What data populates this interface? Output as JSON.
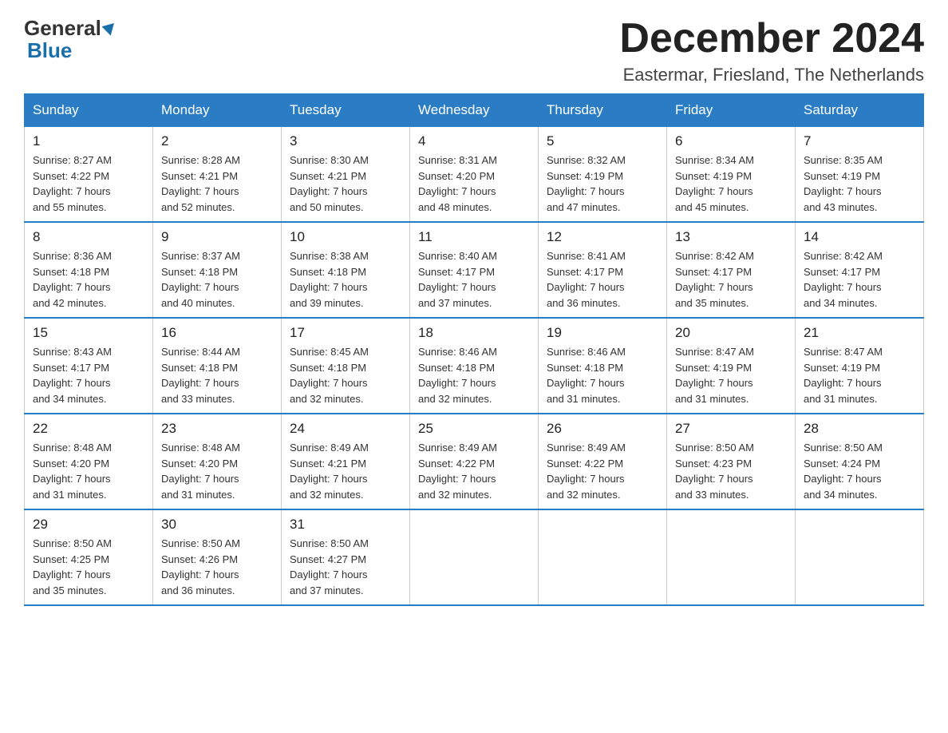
{
  "logo": {
    "line1": "General",
    "line2": "Blue"
  },
  "header": {
    "month": "December 2024",
    "location": "Eastermar, Friesland, The Netherlands"
  },
  "weekdays": [
    "Sunday",
    "Monday",
    "Tuesday",
    "Wednesday",
    "Thursday",
    "Friday",
    "Saturday"
  ],
  "weeks": [
    [
      {
        "day": "1",
        "sunrise": "8:27 AM",
        "sunset": "4:22 PM",
        "daylight": "7 hours and 55 minutes."
      },
      {
        "day": "2",
        "sunrise": "8:28 AM",
        "sunset": "4:21 PM",
        "daylight": "7 hours and 52 minutes."
      },
      {
        "day": "3",
        "sunrise": "8:30 AM",
        "sunset": "4:21 PM",
        "daylight": "7 hours and 50 minutes."
      },
      {
        "day": "4",
        "sunrise": "8:31 AM",
        "sunset": "4:20 PM",
        "daylight": "7 hours and 48 minutes."
      },
      {
        "day": "5",
        "sunrise": "8:32 AM",
        "sunset": "4:19 PM",
        "daylight": "7 hours and 47 minutes."
      },
      {
        "day": "6",
        "sunrise": "8:34 AM",
        "sunset": "4:19 PM",
        "daylight": "7 hours and 45 minutes."
      },
      {
        "day": "7",
        "sunrise": "8:35 AM",
        "sunset": "4:19 PM",
        "daylight": "7 hours and 43 minutes."
      }
    ],
    [
      {
        "day": "8",
        "sunrise": "8:36 AM",
        "sunset": "4:18 PM",
        "daylight": "7 hours and 42 minutes."
      },
      {
        "day": "9",
        "sunrise": "8:37 AM",
        "sunset": "4:18 PM",
        "daylight": "7 hours and 40 minutes."
      },
      {
        "day": "10",
        "sunrise": "8:38 AM",
        "sunset": "4:18 PM",
        "daylight": "7 hours and 39 minutes."
      },
      {
        "day": "11",
        "sunrise": "8:40 AM",
        "sunset": "4:17 PM",
        "daylight": "7 hours and 37 minutes."
      },
      {
        "day": "12",
        "sunrise": "8:41 AM",
        "sunset": "4:17 PM",
        "daylight": "7 hours and 36 minutes."
      },
      {
        "day": "13",
        "sunrise": "8:42 AM",
        "sunset": "4:17 PM",
        "daylight": "7 hours and 35 minutes."
      },
      {
        "day": "14",
        "sunrise": "8:42 AM",
        "sunset": "4:17 PM",
        "daylight": "7 hours and 34 minutes."
      }
    ],
    [
      {
        "day": "15",
        "sunrise": "8:43 AM",
        "sunset": "4:17 PM",
        "daylight": "7 hours and 34 minutes."
      },
      {
        "day": "16",
        "sunrise": "8:44 AM",
        "sunset": "4:18 PM",
        "daylight": "7 hours and 33 minutes."
      },
      {
        "day": "17",
        "sunrise": "8:45 AM",
        "sunset": "4:18 PM",
        "daylight": "7 hours and 32 minutes."
      },
      {
        "day": "18",
        "sunrise": "8:46 AM",
        "sunset": "4:18 PM",
        "daylight": "7 hours and 32 minutes."
      },
      {
        "day": "19",
        "sunrise": "8:46 AM",
        "sunset": "4:18 PM",
        "daylight": "7 hours and 31 minutes."
      },
      {
        "day": "20",
        "sunrise": "8:47 AM",
        "sunset": "4:19 PM",
        "daylight": "7 hours and 31 minutes."
      },
      {
        "day": "21",
        "sunrise": "8:47 AM",
        "sunset": "4:19 PM",
        "daylight": "7 hours and 31 minutes."
      }
    ],
    [
      {
        "day": "22",
        "sunrise": "8:48 AM",
        "sunset": "4:20 PM",
        "daylight": "7 hours and 31 minutes."
      },
      {
        "day": "23",
        "sunrise": "8:48 AM",
        "sunset": "4:20 PM",
        "daylight": "7 hours and 31 minutes."
      },
      {
        "day": "24",
        "sunrise": "8:49 AM",
        "sunset": "4:21 PM",
        "daylight": "7 hours and 32 minutes."
      },
      {
        "day": "25",
        "sunrise": "8:49 AM",
        "sunset": "4:22 PM",
        "daylight": "7 hours and 32 minutes."
      },
      {
        "day": "26",
        "sunrise": "8:49 AM",
        "sunset": "4:22 PM",
        "daylight": "7 hours and 32 minutes."
      },
      {
        "day": "27",
        "sunrise": "8:50 AM",
        "sunset": "4:23 PM",
        "daylight": "7 hours and 33 minutes."
      },
      {
        "day": "28",
        "sunrise": "8:50 AM",
        "sunset": "4:24 PM",
        "daylight": "7 hours and 34 minutes."
      }
    ],
    [
      {
        "day": "29",
        "sunrise": "8:50 AM",
        "sunset": "4:25 PM",
        "daylight": "7 hours and 35 minutes."
      },
      {
        "day": "30",
        "sunrise": "8:50 AM",
        "sunset": "4:26 PM",
        "daylight": "7 hours and 36 minutes."
      },
      {
        "day": "31",
        "sunrise": "8:50 AM",
        "sunset": "4:27 PM",
        "daylight": "7 hours and 37 minutes."
      },
      null,
      null,
      null,
      null
    ]
  ],
  "labels": {
    "sunrise": "Sunrise:",
    "sunset": "Sunset:",
    "daylight": "Daylight:"
  }
}
